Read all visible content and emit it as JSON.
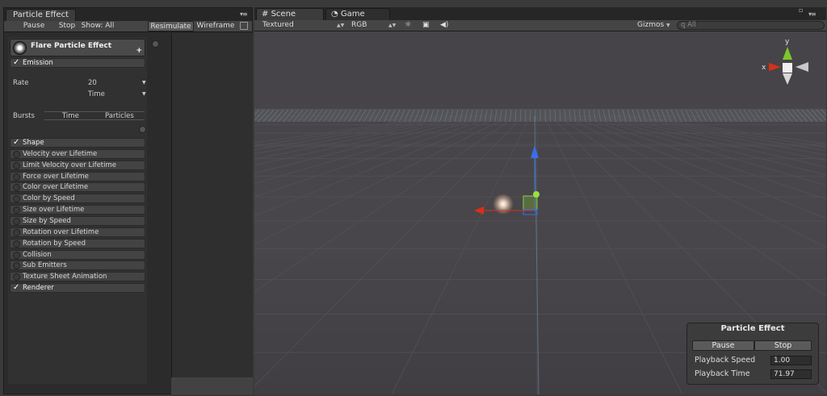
{
  "particle_panel": {
    "tab_title": "Particle Effect",
    "toolbar": {
      "pause": "Pause",
      "stop": "Stop",
      "show_all": "Show: All",
      "resimulate": "Resimulate",
      "wireframe": "Wireframe"
    },
    "system_name": "Flare Particle Effect",
    "emission": {
      "label": "Emission",
      "rate_label": "Rate",
      "rate_value": "20",
      "rate_mode": "Time",
      "bursts_label": "Bursts",
      "burst_col_time": "Time",
      "burst_col_particles": "Particles"
    },
    "modules": [
      {
        "label": "Shape",
        "enabled": true
      },
      {
        "label": "Velocity over Lifetime",
        "enabled": false
      },
      {
        "label": "Limit Velocity over Lifetime",
        "enabled": false
      },
      {
        "label": "Force over Lifetime",
        "enabled": false
      },
      {
        "label": "Color over Lifetime",
        "enabled": false
      },
      {
        "label": "Color by Speed",
        "enabled": false
      },
      {
        "label": "Size over Lifetime",
        "enabled": false
      },
      {
        "label": "Size by Speed",
        "enabled": false
      },
      {
        "label": "Rotation over Lifetime",
        "enabled": false
      },
      {
        "label": "Rotation by Speed",
        "enabled": false
      },
      {
        "label": "Collision",
        "enabled": false
      },
      {
        "label": "Sub Emitters",
        "enabled": false
      },
      {
        "label": "Texture Sheet Animation",
        "enabled": false
      },
      {
        "label": "Renderer",
        "enabled": true
      }
    ]
  },
  "scene": {
    "tabs": [
      {
        "label": "Scene",
        "active": true
      },
      {
        "label": "Game",
        "active": false
      }
    ],
    "toolbar": {
      "render_mode": "Textured",
      "color_mode": "RGB",
      "gizmos": "Gizmos",
      "search_placeholder": "All"
    },
    "axis_labels": {
      "x": "x",
      "y": "y"
    },
    "colors": {
      "x_axis": "#d83018",
      "y_axis": "#7ac82a",
      "z_axis": "#3a6ee8"
    }
  },
  "overlay": {
    "title": "Particle Effect",
    "pause": "Pause",
    "stop": "Stop",
    "speed_label": "Playback Speed",
    "speed_value": "1.00",
    "time_label": "Playback Time",
    "time_value": "71.97"
  }
}
